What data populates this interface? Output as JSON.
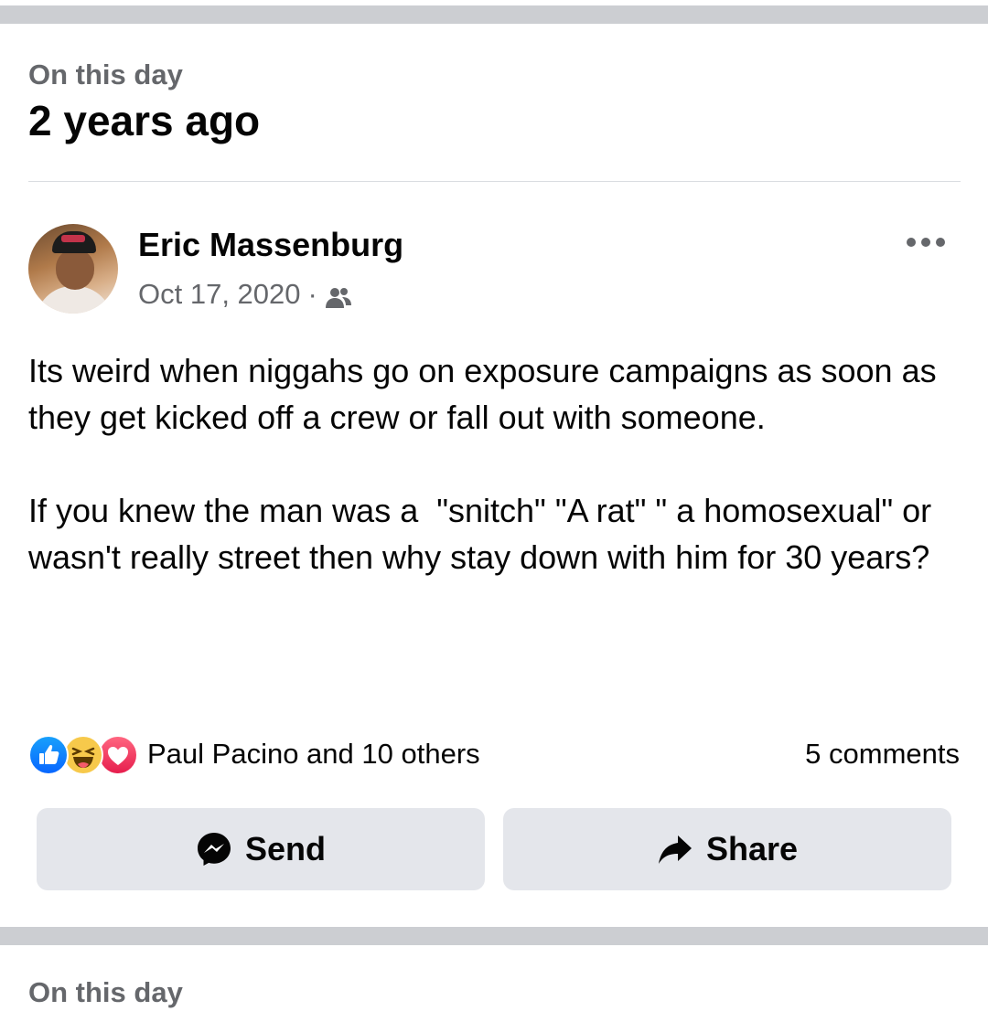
{
  "memory": {
    "label": "On this day",
    "title": "2 years ago"
  },
  "post": {
    "author": "Eric Massenburg",
    "date": "Oct 17, 2020",
    "separator": "·",
    "audience_icon": "friends-icon",
    "more_icon": "more-options-icon",
    "text": "Its weird when niggahs go on exposure campaigns as soon as they get kicked off a crew or fall out with someone.\n\nIf you knew the man was a  \"snitch\" \"A rat\" \" a homosexual\" or wasn't really street then why stay down with him for 30 years?"
  },
  "reactions": {
    "icons": [
      "like-icon",
      "haha-icon",
      "love-icon"
    ],
    "summary": "Paul Pacino and 10 others",
    "comments": "5 comments"
  },
  "actions": {
    "send_label": "Send",
    "send_icon": "messenger-icon",
    "share_label": "Share",
    "share_icon": "share-arrow-icon"
  },
  "next_card": {
    "label": "On this day"
  },
  "colors": {
    "band": "#ccced2",
    "secondary_text": "#65676b",
    "button_bg": "#e4e6eb",
    "like_blue": "#0866ff",
    "love_red": "#e61e4d",
    "haha_yellow": "#f7c94b"
  }
}
